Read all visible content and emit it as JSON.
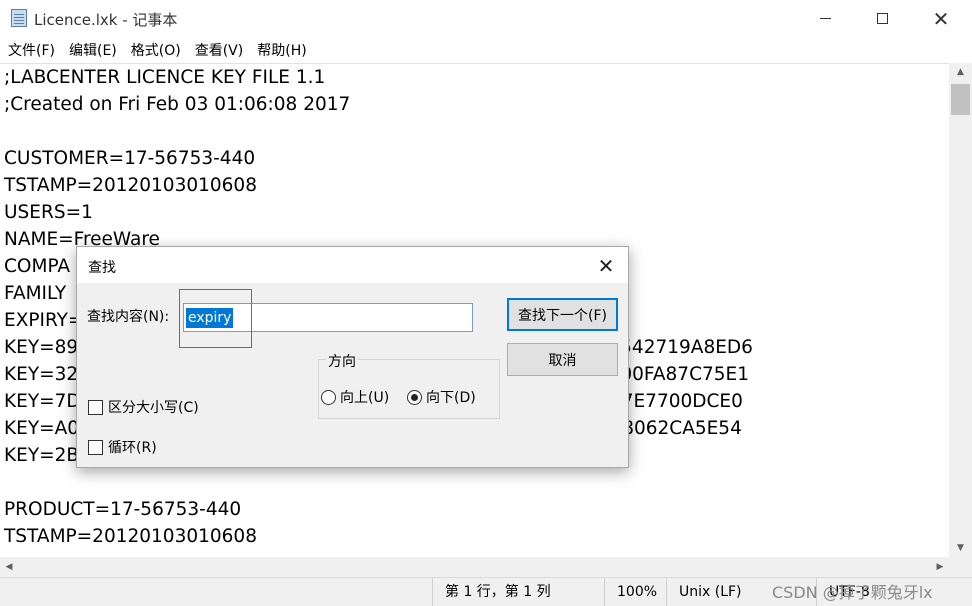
{
  "window": {
    "title": "Licence.lxk - 记事本",
    "minimize": "—",
    "maximize": "□",
    "close": "✕"
  },
  "menu": [
    "文件(F)",
    "编辑(E)",
    "格式(O)",
    "查看(V)",
    "帮助(H)"
  ],
  "editor": {
    "lines": [
      ";LABCENTER LICENCE KEY FILE 1.1",
      ";Created on Fri Feb 03 01:06:08 2017",
      "",
      "CUSTOMER=17-56753-440",
      "TSTAMP=20120103010608",
      "USERS=1",
      "NAME=FreeWare",
      "COMPA",
      "FAMILY",
      "EXPIRY=",
      "KEY=89                                                                              004706B542719A8ED6",
      "KEY=32                                                                              C06823800FA87C75E1",
      "KEY=7D                                                                              29395477E7700DCE0",
      "KEY=A0                                                                              5B1579C8062CA5E54",
      "KEY=2B                                                                              01",
      "",
      "PRODUCT=17-56753-440",
      "TSTAMP=20120103010608"
    ]
  },
  "statusbar": {
    "position": "第 1 行，第 1 列",
    "zoom": "100%",
    "line_ending": "Unix (LF)",
    "encoding": "UTF-8",
    "watermark": "CSDN @掉了颗兔牙lx"
  },
  "find_dialog": {
    "title": "查找",
    "close": "✕",
    "find_label": "查找内容(N):",
    "find_value": "expiry",
    "find_next_button": "查找下一个(F)",
    "cancel_button": "取消",
    "direction_label": "方向",
    "direction_up": "向上(U)",
    "direction_down": "向下(D)",
    "direction_selected": "down",
    "match_case": "区分大小写(C)",
    "wrap_around": "循环(R)"
  }
}
